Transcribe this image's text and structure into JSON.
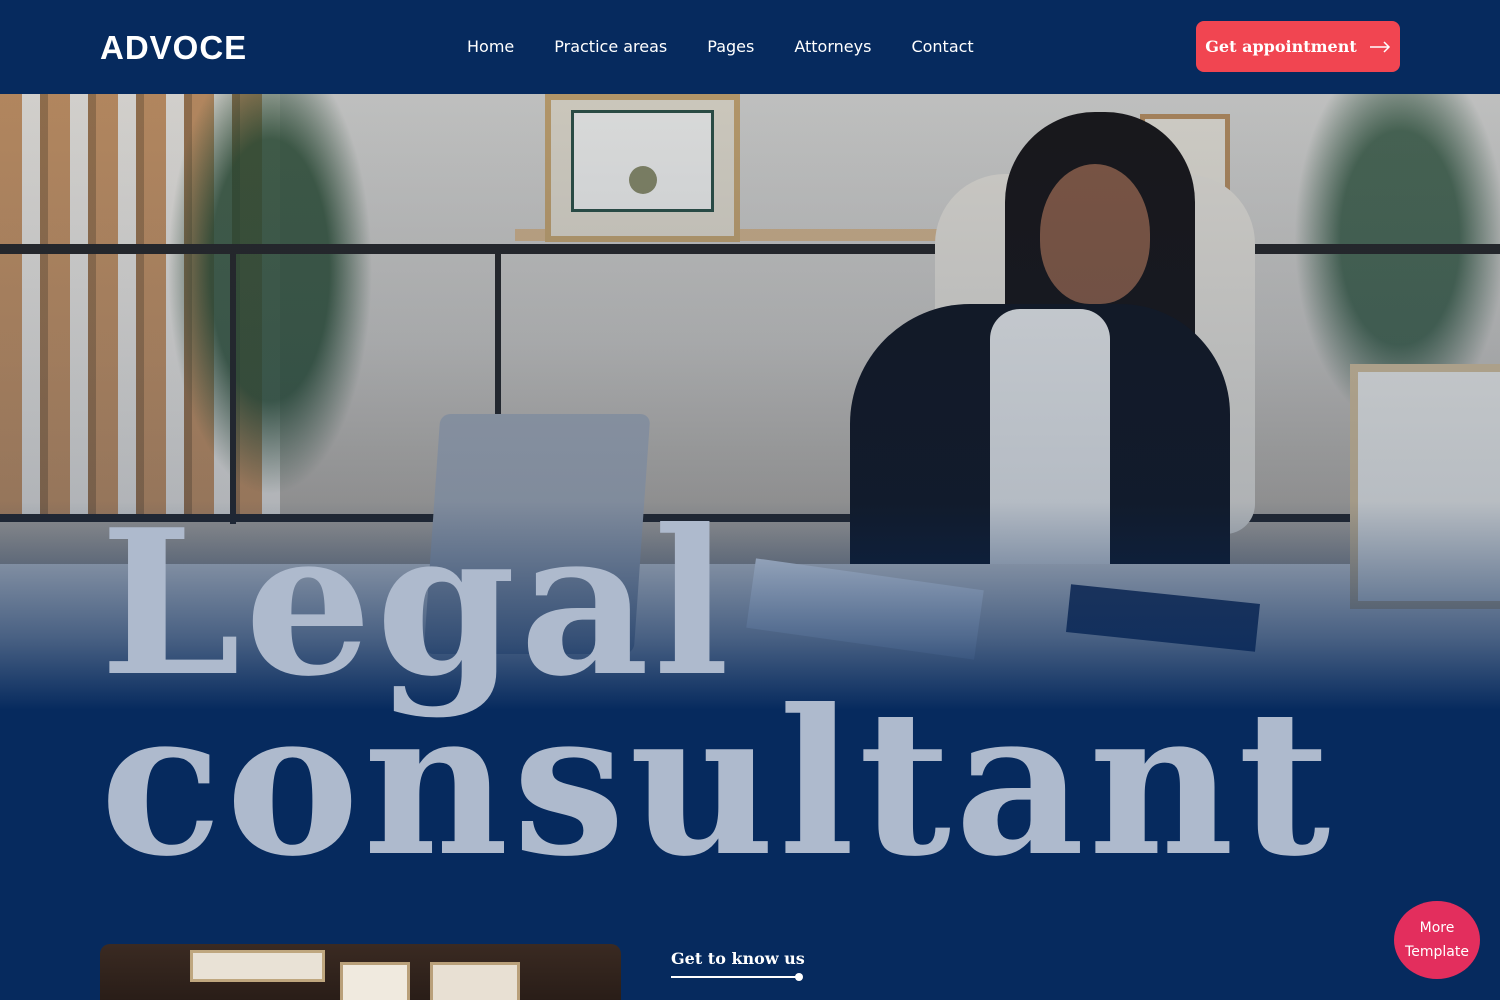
{
  "brand": {
    "logo": "ADVOCE"
  },
  "nav": {
    "items": [
      "Home",
      "Practice areas",
      "Pages",
      "Attorneys",
      "Contact"
    ]
  },
  "header": {
    "cta_label": "Get appointment",
    "cta_icon": "arrow-right-icon"
  },
  "hero": {
    "title_line1": "Legal",
    "title_line2": "consultant",
    "get_to_know": "Get to know us"
  },
  "floating": {
    "more_template": "More Template"
  },
  "colors": {
    "navy": "#062a5e",
    "accent": "#f14551",
    "title_text": "#aebacd",
    "badge": "#e32e5d"
  }
}
